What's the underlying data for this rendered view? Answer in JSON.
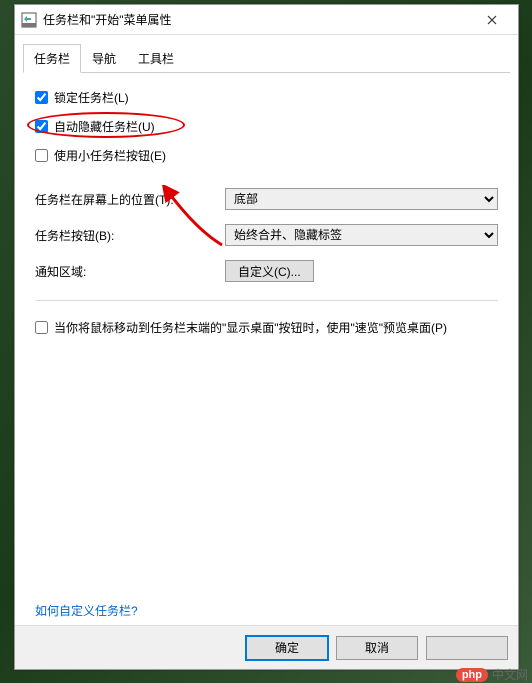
{
  "titlebar": {
    "title": "任务栏和\"开始\"菜单属性"
  },
  "tabs": {
    "taskbar": "任务栏",
    "navigation": "导航",
    "toolbars": "工具栏"
  },
  "checks": {
    "lock": "锁定任务栏(L)",
    "autohide": "自动隐藏任务栏(U)",
    "small": "使用小任务栏按钮(E)",
    "peek": "当你将鼠标移动到任务栏末端的\"显示桌面\"按钮时，使用\"速览\"预览桌面(P)"
  },
  "form": {
    "position_label": "任务栏在屏幕上的位置(T):",
    "position_value": "底部",
    "buttons_label": "任务栏按钮(B):",
    "buttons_value": "始终合并、隐藏标签",
    "notify_label": "通知区域:",
    "notify_btn": "自定义(C)..."
  },
  "link": "如何自定义任务栏?",
  "buttons": {
    "ok": "确定",
    "cancel": "取消"
  },
  "watermark": {
    "php": "php",
    "text": "中文网"
  }
}
